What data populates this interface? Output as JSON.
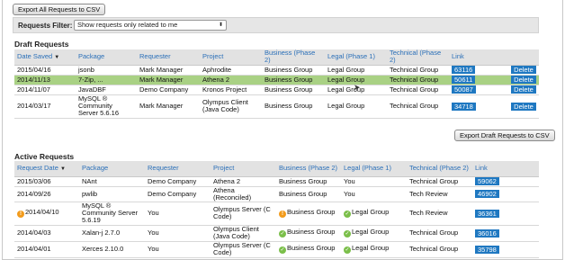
{
  "toolbar": {
    "export_all_label": "Export All Requests to CSV"
  },
  "filter": {
    "label": "Requests Filter:",
    "selected": "Show requests only related to me",
    "arrow": "⬍"
  },
  "draft": {
    "title": "Draft Requests",
    "headers": {
      "date": "Date Saved",
      "package": "Package",
      "requester": "Requester",
      "project": "Project",
      "business": "Business (Phase 2)",
      "legal": "Legal (Phase 1)",
      "technical": "Technical (Phase 2)",
      "link": "Link"
    },
    "sort_arrow": "▼",
    "rows": [
      {
        "date": "2015/04/16",
        "package": "jsonb",
        "requester": "Mark Manager",
        "project": "Aphrodite",
        "business": "Business Group",
        "legal": "Legal Group",
        "technical": "Technical Group",
        "link": "63116",
        "delete": "Delete"
      },
      {
        "date": "2014/11/13",
        "package": "7-Zip, ...",
        "requester": "Mark Manager",
        "project": "Athena 2",
        "business": "Business Group",
        "legal": "Legal Group",
        "technical": "Technical Group",
        "link": "50611",
        "delete": "Delete"
      },
      {
        "date": "2014/11/07",
        "package": "JavaDBF",
        "requester": "Demo Company",
        "project": "Kronos Project",
        "business": "Business Group",
        "legal": "Legal Group",
        "technical": "Technical Group",
        "link": "50087",
        "delete": "Delete"
      },
      {
        "date": "2014/03/17",
        "package": "MySQL ® Community Server 5.6.16",
        "requester": "Mark Manager",
        "project": "Olympus Client (Java Code)",
        "business": "Business Group",
        "legal": "Legal Group",
        "technical": "Technical Group",
        "link": "34718",
        "delete": "Delete"
      }
    ],
    "export_label": "Export Draft Requests to CSV"
  },
  "active": {
    "title": "Active Requests",
    "headers": {
      "date": "Request Date",
      "package": "Package",
      "requester": "Requester",
      "project": "Project",
      "business": "Business (Phase 2)",
      "legal": "Legal (Phase 1)",
      "technical": "Technical (Phase 2)",
      "link": "Link"
    },
    "sort_arrow": "▼",
    "rows": [
      {
        "date": "2015/03/06",
        "package": "NAnt",
        "requester": "Demo Company",
        "project": "Athena 2",
        "business": "Business Group",
        "legal": "You",
        "technical": "Technical Group",
        "link": "59062"
      },
      {
        "date": "2014/09/26",
        "package": "pwlib",
        "requester": "Demo Company",
        "project": "Athena (Reconciled)",
        "business": "Business Group",
        "legal": "You",
        "technical": "Tech Review",
        "link": "46902"
      },
      {
        "date": "2014/04/10",
        "package": "MySQL ® Community Server 5.6.19",
        "requester": "You",
        "project": "Olympus Server (C Code)",
        "business": "Business Group",
        "legal": "Legal Group",
        "technical": "Tech Review",
        "link": "36361"
      },
      {
        "date": "2014/04/03",
        "package": "Xalan-j 2.7.0",
        "requester": "You",
        "project": "Olympus Client (Java Code)",
        "business": "Business Group",
        "legal": "Legal Group",
        "technical": "Technical Group",
        "link": "36016"
      },
      {
        "date": "2014/04/01",
        "package": "Xerces 2.10.0",
        "requester": "You",
        "project": "Olympus Server (C Code)",
        "business": "Business Group",
        "legal": "Legal Group",
        "technical": "Technical Group",
        "link": "35798"
      }
    ]
  },
  "icons": {
    "warning": "!",
    "check": "✓"
  },
  "colors": {
    "link_badge": "#1f78c1",
    "highlight_row": "#a9d184",
    "header_text": "#2a6fb8",
    "warning": "#f29b1c",
    "approved": "#7bbf4a"
  }
}
